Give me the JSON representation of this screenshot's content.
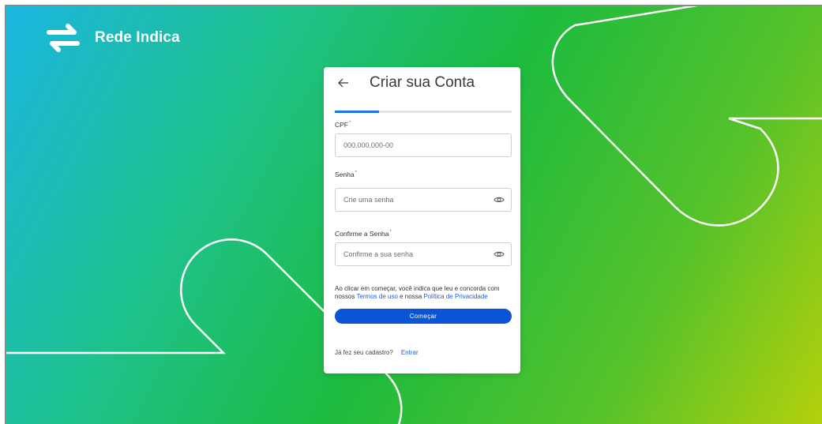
{
  "brand": {
    "name": "Rede Indica"
  },
  "form": {
    "title": "Criar sua Conta",
    "progress_fraction": 0.25,
    "cpf": {
      "label": "CPF",
      "required_mark": "*",
      "placeholder": "000.000.000-00"
    },
    "senha": {
      "label": "Senha",
      "required_mark": "*",
      "placeholder": "Crie uma senha"
    },
    "confirme": {
      "label": "Confirme a Senha",
      "required_mark": "*",
      "placeholder": "Confirme a sua senha"
    },
    "terms": {
      "text_1": "Ao clicar em começar, você indica que leu e concorda com nossos ",
      "link_terms": "Termos de uso",
      "text_2": " e nossa ",
      "link_privacy": "Política de Privacidade"
    },
    "submit_label": "Começar",
    "login_prompt": "Já fez seu cadastro?",
    "login_link": "Entrar"
  },
  "colors": {
    "primary": "#0a55d6",
    "link": "#1a5fd0",
    "gradient_start": "#1cb5e0",
    "gradient_mid": "#1dbb3f",
    "gradient_end": "#b4d00c"
  },
  "icons": {
    "brand": "swap-arrows-icon",
    "back": "arrow-left-icon",
    "password_toggle": "eye-icon"
  }
}
